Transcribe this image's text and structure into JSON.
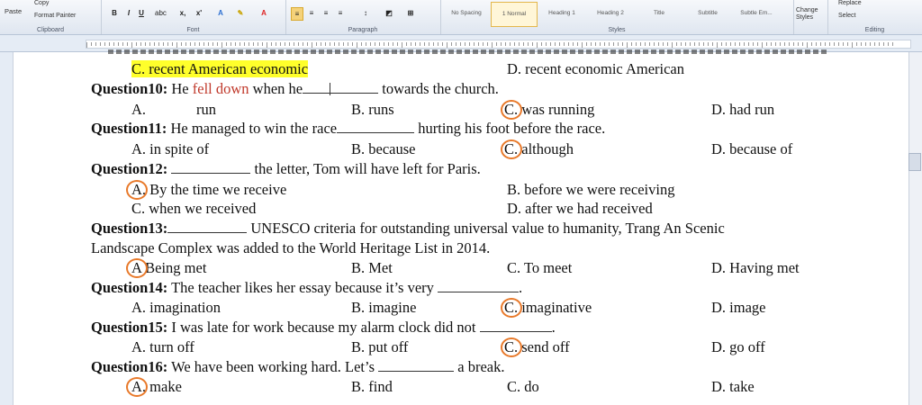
{
  "ribbon": {
    "clipboard": {
      "paste": "Paste",
      "copy": "Copy",
      "format_painter": "Format Painter",
      "label": "Clipboard"
    },
    "font_label": "Font",
    "paragraph_label": "Paragraph",
    "styles": {
      "label": "Styles",
      "items": [
        "No Spacing",
        "1 Normal",
        "Heading 1",
        "Heading 2",
        "Title",
        "Subtitle",
        "Subtle Em..."
      ]
    },
    "change_styles": "Change Styles",
    "editing": {
      "replace": "Replace",
      "select": "Select",
      "label": "Editing"
    }
  },
  "lines": {
    "l1a": "C. recent American economic",
    "l1b": "D. recent economic American",
    "q10_label": "Question10:",
    "q10_pre": " He ",
    "q10_red": "fell down",
    "q10_mid": " when he",
    "q10_post": " towards the church.",
    "q10_a": "A.",
    "q10_a2": "run",
    "q10_b": "B. runs",
    "q10_c": "C. was running",
    "q10_d": "D. had run",
    "q11_label": "Question11:",
    "q11_text": " He managed to win the race",
    "q11_post": " hurting his foot before the race.",
    "q11_a": "A. in spite of",
    "q11_b": "B. because",
    "q11_c": "C. although",
    "q11_d": "D. because of",
    "q12_label": "Question12:",
    "q12_post": " the letter, Tom will have left for Paris.",
    "q12_a": "A. By the time we receive",
    "q12_b": "B. before we were receiving",
    "q12_c": "C. when we received",
    "q12_d": "D. after we had received",
    "q13_label": "Question13:",
    "q13_post": " UNESCO criteria for outstanding universal value to humanity, Trang An Scenic",
    "q13_line2": "Landscape Complex was added to the World Heritage List in 2014.",
    "q13_a": "A  Being met",
    "q13_b": "B. Met",
    "q13_c": "C. To meet",
    "q13_d": "D. Having met",
    "q14_label": "Question14:",
    "q14_text": " The teacher likes her essay because it’s very",
    "q14_end": ".",
    "q14_a": "A. imagination",
    "q14_b": "B. imagine",
    "q14_c": "C. imaginative",
    "q14_d": "D. image",
    "q15_label": "Question15:",
    "q15_text": " I was late for work because my alarm clock did not",
    "q15_end": ".",
    "q15_a": "A. turn off",
    "q15_b": "B. put off",
    "q15_c": "C. send off",
    "q15_d": "D. go off",
    "q16_label": "Question16:",
    "q16_text": " We have been working hard. Let’s",
    "q16_post": " a break.",
    "q16_a": "A.   make",
    "q16_b": "B. find",
    "q16_c": "C. do",
    "q16_d": "D. take"
  },
  "colors": {
    "highlight": "#ffff2b",
    "circle": "#e8792a",
    "red_text": "#c0392b"
  }
}
